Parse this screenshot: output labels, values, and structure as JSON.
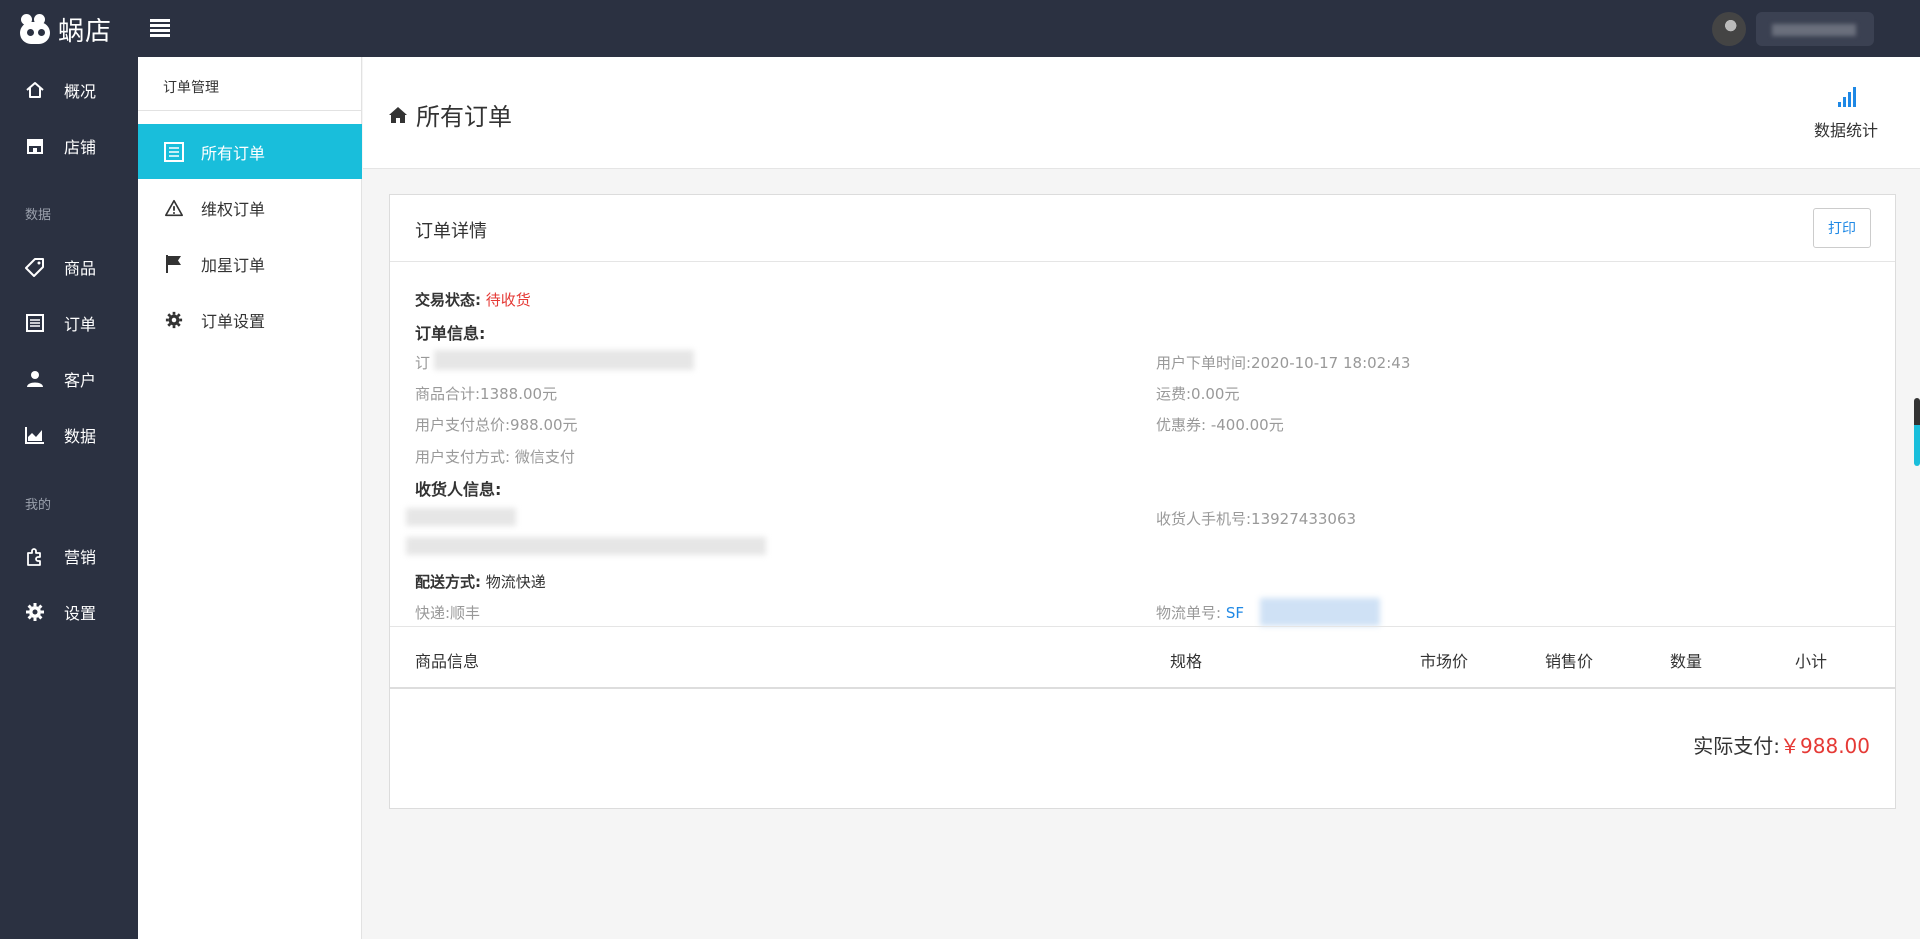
{
  "app": {
    "logo_text": "蜗店"
  },
  "nav": {
    "items": [
      {
        "label": "概况",
        "icon": "home-icon"
      },
      {
        "label": "店铺",
        "icon": "store-icon"
      },
      {
        "label": "商品",
        "icon": "tag-icon"
      },
      {
        "label": "订单",
        "icon": "list-icon"
      },
      {
        "label": "客户",
        "icon": "user-icon"
      },
      {
        "label": "数据",
        "icon": "chart-icon"
      },
      {
        "label": "营销",
        "icon": "puzzle-icon"
      },
      {
        "label": "设置",
        "icon": "gear-icon"
      }
    ],
    "groups": [
      "数据",
      "我的"
    ]
  },
  "subnav": {
    "title": "订单管理",
    "items": [
      {
        "label": "所有订单",
        "icon": "list-icon",
        "active": true
      },
      {
        "label": "维权订单",
        "icon": "warning-icon",
        "active": false
      },
      {
        "label": "加星订单",
        "icon": "flag-icon",
        "active": false
      },
      {
        "label": "订单设置",
        "icon": "gear-icon",
        "active": false
      }
    ]
  },
  "header": {
    "title": "所有订单",
    "stats_label": "数据统计"
  },
  "card": {
    "title": "订单详情",
    "print_label": "打印",
    "status_label": "交易状态:",
    "status_value": "待收货",
    "order_info_label": "订单信息:",
    "order_no_prefix": "订",
    "order_time": "用户下单时间:2020-10-17 18:02:43",
    "goods_total": "商品合计:1388.00元",
    "shipping_fee": "运费:0.00元",
    "paid_total": "用户支付总价:988.00元",
    "coupon": "优惠券: -400.00元",
    "pay_method": "用户支付方式:  微信支付",
    "receiver_label": "收货人信息:",
    "receiver_phone": "收货人手机号:13927433063",
    "delivery_label": "配送方式:",
    "delivery_value": "物流快递",
    "courier": "快递:顺丰",
    "tracking_label": "物流单号:",
    "tracking_prefix": "SF"
  },
  "table": {
    "columns": [
      "商品信息",
      "规格",
      "市场价",
      "销售价",
      "数量",
      "小计"
    ]
  },
  "total": {
    "label": "实际支付:",
    "amount": "￥988.00"
  },
  "colors": {
    "topbar": "#2b3141",
    "accent": "#19bedb",
    "link": "#1e88e5",
    "danger": "#e53935"
  }
}
